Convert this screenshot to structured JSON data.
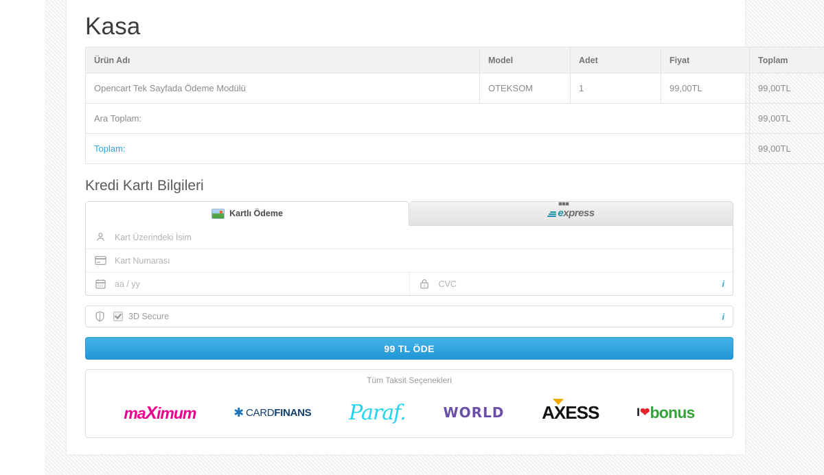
{
  "page": {
    "title": "Kasa"
  },
  "cart": {
    "columns": [
      "Ürün Adı",
      "Model",
      "Adet",
      "Fiyat",
      "Toplam"
    ],
    "rows": [
      {
        "name": "Opencart Tek Sayfada Ödeme Modülü",
        "model": "OTEKSOM",
        "qty": "1",
        "price": "99,00TL",
        "total": "99,00TL"
      }
    ],
    "summary": [
      {
        "label": "Ara Toplam:",
        "value": "99,00TL"
      },
      {
        "label": "Toplam:",
        "value": "99,00TL"
      }
    ]
  },
  "credit_card": {
    "heading": "Kredi Kartı Bilgileri",
    "tabs": [
      {
        "label": "Kartlı Ödeme",
        "icon": "card-image-icon",
        "active": true
      },
      {
        "label": "BKM Express",
        "icon": "bkm-express-logo",
        "active": false
      }
    ],
    "fields": {
      "holder_name": {
        "placeholder": "Kart Üzerindeki İsim",
        "value": "",
        "icon": "person-icon"
      },
      "card_number": {
        "placeholder": "Kart Numarası",
        "value": "",
        "icon": "credit-card-icon"
      },
      "expiry": {
        "placeholder": "aa / yy",
        "value": "",
        "icon": "calendar-icon"
      },
      "cvc": {
        "placeholder": "CVC",
        "value": "",
        "icon": "lock-icon",
        "info": "i"
      }
    },
    "secure": {
      "label": "3D Secure",
      "checked": true,
      "icon": "shield-icon",
      "info": "i"
    },
    "pay_button": "99 TL ÖDE"
  },
  "installments": {
    "title": "Tüm Taksit Seçenekleri",
    "logos": [
      {
        "name": "maximum",
        "label": "maximum",
        "color": "#ec008c"
      },
      {
        "name": "cardfinans",
        "label": "CARDFINANS",
        "color": "#123f6d"
      },
      {
        "name": "paraf",
        "label": "Paraf.",
        "color": "#22d3ee"
      },
      {
        "name": "world",
        "label": "WORLD",
        "color": "#6b4ea8"
      },
      {
        "name": "axess",
        "label": "AXESS",
        "color": "#111111"
      },
      {
        "name": "bonus",
        "label": "bonus",
        "color": "#34a23a"
      }
    ]
  },
  "colors": {
    "accent": "#2ba6e0",
    "button": "#2196d6",
    "text": "#6f6f6f"
  }
}
